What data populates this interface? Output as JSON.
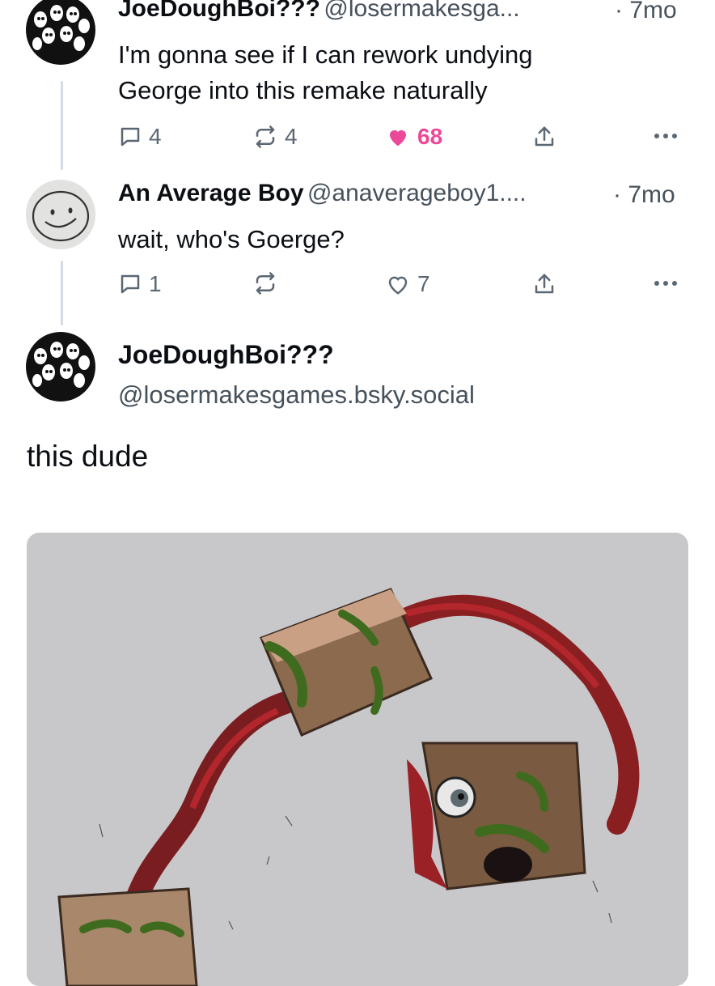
{
  "post1": {
    "author_name": "JoeDoughBoi???",
    "handle": "@losermakesga...",
    "time": "· 7mo",
    "text_line1": "I'm gonna see if I can rework undying",
    "text_line2": "George into this remake naturally",
    "replies": "4",
    "reposts": "4",
    "likes": "68",
    "liked": true
  },
  "post2": {
    "author_name": "An Average Boy",
    "handle": "@anaverageboy1....",
    "time": "· 7mo",
    "text": "wait, who's Goerge?",
    "replies": "1",
    "reposts": "",
    "likes": "7"
  },
  "main_post": {
    "author_name": "JoeDoughBoi???",
    "handle": "@losermakesgames.bsky.social",
    "text": "this dude"
  },
  "colors": {
    "like_pink": "#ec4899",
    "muted_gray": "#46515c",
    "image_bg": "#c8c8ca"
  },
  "icons": [
    "reply-icon",
    "repost-icon",
    "heart-icon",
    "share-icon",
    "more-icon"
  ]
}
